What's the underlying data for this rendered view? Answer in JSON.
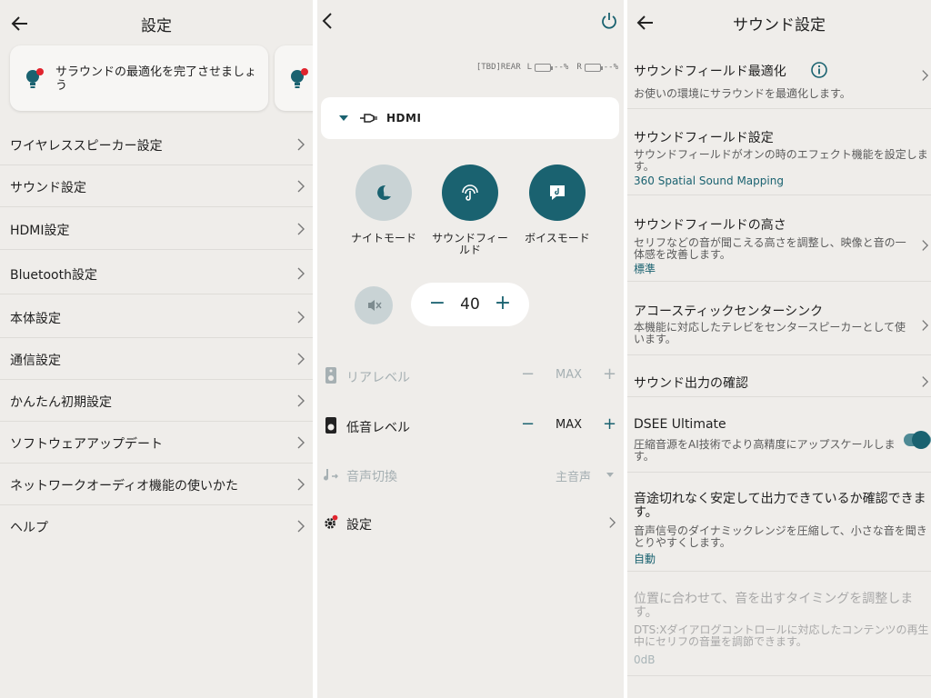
{
  "settings_panel": {
    "title": "設定",
    "notification_card": {
      "text": "サラウンドの最適化を完了させましょう"
    },
    "menu_items": [
      {
        "label": "ワイヤレススピーカー設定"
      },
      {
        "label": "サウンド設定"
      },
      {
        "label": "HDMI設定"
      },
      {
        "label": "Bluetooth設定"
      },
      {
        "label": "本体設定"
      },
      {
        "label": "通信設定"
      },
      {
        "label": "かんたん初期設定"
      },
      {
        "label": "ソフトウェアアップデート"
      },
      {
        "label": "ネットワークオーディオ機能の使いかた"
      },
      {
        "label": "ヘルプ"
      }
    ]
  },
  "control_panel": {
    "battery": {
      "model": "[TBD]REAR",
      "left_label": "L",
      "left_value": "--%",
      "right_label": "R",
      "right_value": "--%"
    },
    "input": {
      "label": "HDMI"
    },
    "modes": [
      {
        "label": "ナイトモード"
      },
      {
        "label": "サウンドフィールド"
      },
      {
        "label": "ボイスモード"
      }
    ],
    "volume": {
      "value": "40",
      "minus": "−",
      "plus": "+"
    },
    "rear_level": {
      "label": "リアレベル",
      "value": "MAX",
      "minus": "−",
      "plus": "+"
    },
    "bass_level": {
      "label": "低音レベル",
      "value": "MAX",
      "minus": "−",
      "plus": "+"
    },
    "audio_switch": {
      "label": "音声切換",
      "value": "主音声"
    },
    "settings": {
      "label": "設定"
    }
  },
  "sound_panel": {
    "title": "サウンド設定",
    "items": [
      {
        "title": "サウンドフィールド最適化",
        "desc": "お使いの環境にサラウンドを最適化します。"
      },
      {
        "title": "サウンドフィールド設定",
        "desc": "サウンドフィールドがオンの時のエフェクト機能を設定します。",
        "value": "360 Spatial Sound Mapping"
      },
      {
        "title": "サウンドフィールドの高さ",
        "desc": "セリフなどの音が聞こえる高さを調整し、映像と音の一体感を改善します。",
        "value": "標準"
      },
      {
        "title": "アコースティックセンターシンク",
        "desc": "本機能に対応したテレビをセンタースピーカーとして使います。"
      },
      {
        "title": "サウンド出力の確認"
      },
      {
        "title": "DSEE Ultimate",
        "desc": "圧縮音源をAI技術でより高精度にアップスケールします。"
      },
      {
        "title": "音途切れなく安定して出力できているか確認できます。",
        "desc": "音声信号のダイナミックレンジを圧縮して、小さな音を聞きとりやすくします。",
        "value": "自動"
      },
      {
        "title": "位置に合わせて、音を出すタイミングを調整します。",
        "desc": "DTS:Xダイアログコントロールに対応したコンテンツの再生中にセリフの音量を調節できます。",
        "value": "0dB"
      }
    ]
  }
}
